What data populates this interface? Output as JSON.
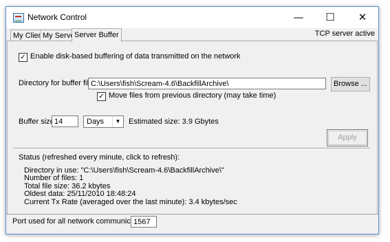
{
  "window": {
    "title": "Network Control",
    "controls": {
      "minimize": "—",
      "maximize": "☐",
      "close": "✕"
    }
  },
  "tabs": [
    {
      "label": "My Client",
      "active": false
    },
    {
      "label": "My Server",
      "active": false
    },
    {
      "label": "Server Buffer",
      "active": true
    }
  ],
  "server_status": "TCP server active",
  "buffer": {
    "enable_label": "Enable disk-based buffering of data transmitted on the network",
    "enable_checked": true,
    "directory_label": "Directory for buffer files:",
    "directory_value": "C:\\Users\\fish\\Scream-4.6\\BackfillArchive\\",
    "browse_label": "Browse ...",
    "move_files_label": "Move files from previous directory (may take time)",
    "move_files_checked": true,
    "size_label": "Buffer size",
    "size_value": "14",
    "size_unit": "Days",
    "estimated_size": "Estimated size: 3.9 Gbytes",
    "apply_label": "Apply"
  },
  "status": {
    "heading": "Status (refreshed every minute, click to refresh):",
    "lines": [
      "Directory in use: \"C:\\Users\\fish\\Scream-4.6\\BackfillArchive\\\"",
      "Number of files: 1",
      "Total file size: 36.2 kbytes",
      "Oldest data: 25/11/2010 18:48:24",
      "Current Tx Rate (averaged over the last minute): 3.4 kbytes/sec"
    ]
  },
  "port": {
    "label": "Port used for all network communications:",
    "value": "1567"
  }
}
